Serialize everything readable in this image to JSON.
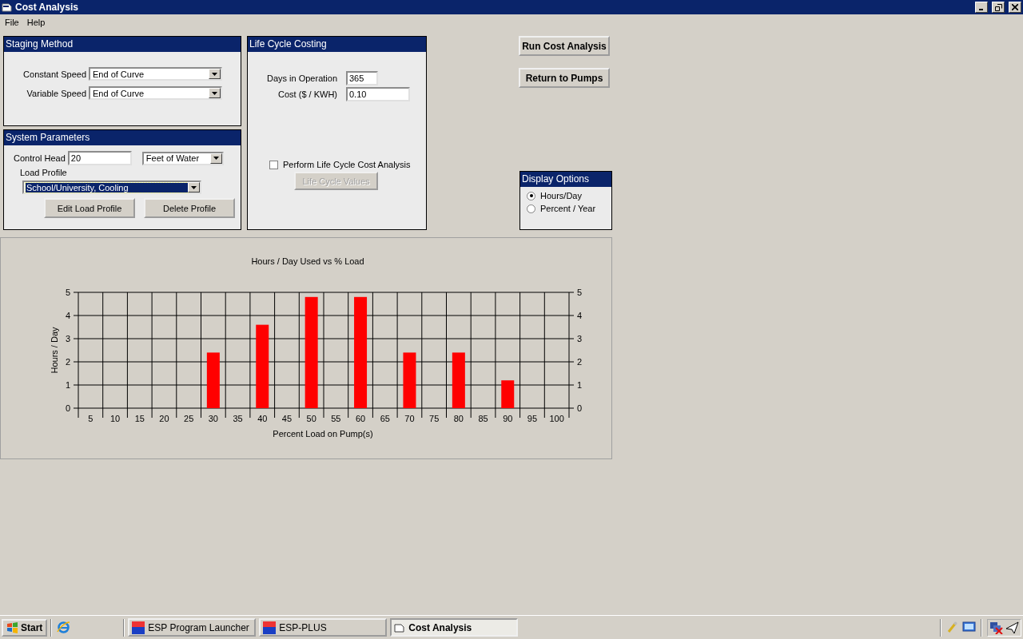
{
  "window": {
    "title": "Cost Analysis"
  },
  "menu": [
    "File",
    "Help"
  ],
  "staging_method": {
    "title": "Staging Method",
    "fields": [
      {
        "label": "Constant Speed",
        "value": "End of Curve"
      },
      {
        "label": "Variable Speed",
        "value": "End of Curve"
      }
    ]
  },
  "system_parameters": {
    "title": "System Parameters",
    "control_head": {
      "label": "Control Head",
      "value": "20",
      "unit": "Feet of Water"
    },
    "load_profile": {
      "label": "Load Profile",
      "value": "School/University, Cooling",
      "highlighted": true
    },
    "buttons": [
      "Edit Load Profile",
      "Delete Profile"
    ]
  },
  "life_cycle_costing": {
    "title": "Life Cycle Costing",
    "fields": [
      {
        "label": "Days in Operation",
        "value": "365"
      },
      {
        "label": "Cost ($ / KWH)",
        "value": "0.10"
      }
    ],
    "perform_analysis": {
      "label": "Perform Life Cycle Cost Analysis",
      "checked": false
    },
    "values_button": {
      "label": "Life Cycle Values",
      "disabled": true
    }
  },
  "actions": [
    "Run Cost Analysis",
    "Return to Pumps"
  ],
  "display_options": {
    "title": "Display Options",
    "options": [
      {
        "label": "Hours/Day",
        "selected": true
      },
      {
        "label": "Percent / Year",
        "selected": false
      }
    ]
  },
  "chart": {
    "chart_data": {
      "type": "bar",
      "title": "Hours / Day Used vs % Load",
      "xlabel": "Percent Load on Pump(s)",
      "ylabel": "Hours / Day",
      "categories": [
        "5",
        "10",
        "15",
        "20",
        "25",
        "30",
        "35",
        "40",
        "45",
        "50",
        "55",
        "60",
        "65",
        "70",
        "75",
        "80",
        "85",
        "90",
        "95",
        "100"
      ],
      "series": [
        {
          "color": "#ff0000",
          "values": [
            0,
            0,
            0,
            0,
            0,
            2.4,
            0,
            3.6,
            0,
            4.8,
            0,
            4.8,
            0,
            2.4,
            0,
            2.4,
            0,
            1.2,
            0,
            0
          ]
        }
      ],
      "ylim": [
        0,
        5
      ],
      "yticks": [
        0,
        1,
        2,
        3,
        4,
        5
      ],
      "y2ticks": [
        0,
        1,
        2,
        3,
        4,
        5
      ],
      "y2lim": [
        0,
        5
      ],
      "grid": true
    }
  },
  "taskbar": {
    "start": "Start",
    "tasks": [
      {
        "label": "ESP Program Launcher",
        "kind": "app",
        "selected": false
      },
      {
        "label": "ESP-PLUS",
        "kind": "app",
        "selected": false
      },
      {
        "label": "Cost Analysis",
        "kind": "window",
        "selected": true
      }
    ]
  }
}
